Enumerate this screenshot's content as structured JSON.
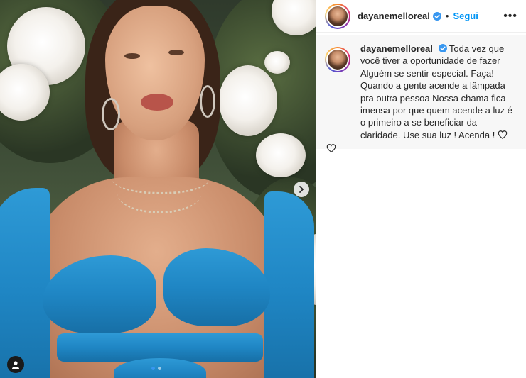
{
  "post": {
    "media_carousel": {
      "slide_index": 1,
      "slide_count": 2
    }
  },
  "header": {
    "username": "dayanemelloreal",
    "separator": "•",
    "follow_label": "Segui",
    "more_label": "•••"
  },
  "caption": {
    "username": "dayanemelloreal",
    "text": "Toda vez que você tiver a oportunidade de fazer Alguém se sentir especial. Faça! Quando a gente acende a lâmpada pra outra pessoa Nossa chama fica imensa por que quem acende a luz é o primeiro a se beneficiar da claridade. Use sua luz ! Acenda !"
  },
  "icons": {
    "next": "chevron-right-icon",
    "user_tag": "user-tag-icon",
    "verified": "verified-badge-icon",
    "like": "heart-icon"
  },
  "colors": {
    "accent": "#0095f6",
    "verified": "#3897f0",
    "carousel_dot_active": "#3897f0",
    "top_color": "#1f86c4"
  }
}
